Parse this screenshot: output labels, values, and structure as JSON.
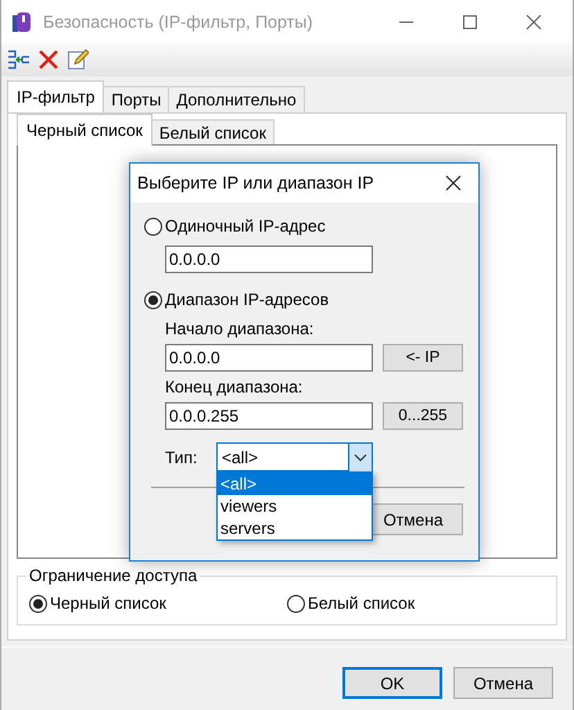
{
  "window": {
    "title": "Безопасность (IP-фильтр, Порты)"
  },
  "tabs": [
    {
      "label": "IP-фильтр",
      "selected": true
    },
    {
      "label": "Порты",
      "selected": false
    },
    {
      "label": "Дополнительно",
      "selected": false
    }
  ],
  "subtabs": [
    {
      "label": "Черный список",
      "selected": true
    },
    {
      "label": "Белый список",
      "selected": false
    }
  ],
  "access": {
    "legend": "Ограничение доступа",
    "options": [
      {
        "label": "Черный список",
        "selected": true
      },
      {
        "label": "Белый список",
        "selected": false
      }
    ]
  },
  "buttons": [
    {
      "label": "OK",
      "default": true
    },
    {
      "label": "Отмена",
      "default": false
    }
  ],
  "dialog": {
    "title": "Выберите IP или диапазон IP",
    "modes": [
      {
        "label": "Одиночный IP-адрес",
        "selected": false,
        "fields": [
          {
            "value": "0.0.0.0"
          }
        ]
      },
      {
        "label": "Диапазон IP-адресов",
        "selected": true,
        "fields": [
          {
            "label": "Начало диапазона:",
            "value": "0.0.0.0",
            "button": "<- IP"
          },
          {
            "label": "Конец диапазона:",
            "value": "0.0.0.255",
            "button": "0...255"
          }
        ]
      }
    ],
    "type": {
      "label": "Тип:",
      "value": "<all>",
      "expanded": true,
      "options": [
        {
          "label": "<all>",
          "selected": true
        },
        {
          "label": "viewers",
          "selected": false
        },
        {
          "label": "servers",
          "selected": false
        }
      ]
    },
    "buttons": [
      "Отмена"
    ]
  }
}
